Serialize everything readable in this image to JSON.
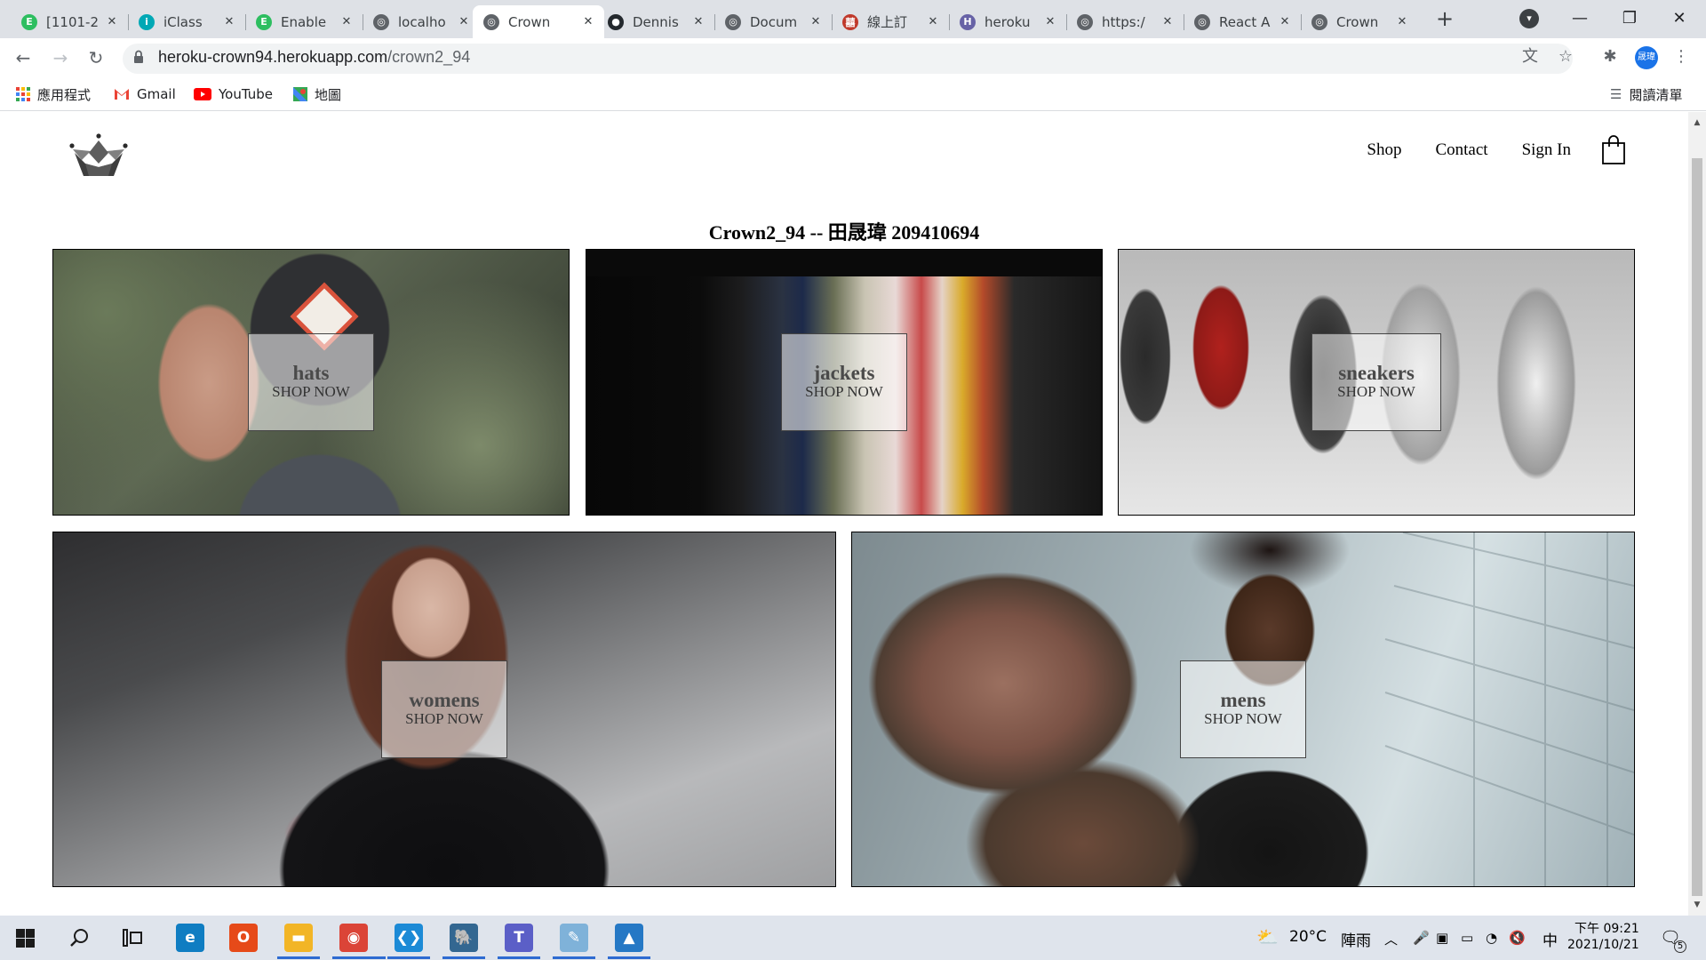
{
  "browser": {
    "tabs": [
      {
        "title": "[1101-2",
        "favicon": "evernote-icon",
        "color": "#2dbe60",
        "glyph": "E"
      },
      {
        "title": "iClass",
        "favicon": "iclass-icon",
        "color": "#00a8b5",
        "glyph": "i"
      },
      {
        "title": "Enable",
        "favicon": "evernote-icon",
        "color": "#2dbe60",
        "glyph": "E"
      },
      {
        "title": "localho",
        "favicon": "globe-icon",
        "color": "#5f6368",
        "glyph": "◎"
      },
      {
        "title": "Crown",
        "favicon": "globe-icon",
        "color": "#5f6368",
        "glyph": "◎"
      },
      {
        "title": "Dennis",
        "favicon": "github-icon",
        "color": "#24292e",
        "glyph": "●"
      },
      {
        "title": "Docum",
        "favicon": "globe-icon",
        "color": "#5f6368",
        "glyph": "◎"
      },
      {
        "title": "線上訂",
        "favicon": "shop-icon",
        "color": "#c0392b",
        "glyph": "囍"
      },
      {
        "title": "heroku",
        "favicon": "heroku-icon",
        "color": "#6762a6",
        "glyph": "H"
      },
      {
        "title": "https:/",
        "favicon": "globe-icon",
        "color": "#5f6368",
        "glyph": "◎"
      },
      {
        "title": "React A",
        "favicon": "globe-icon",
        "color": "#5f6368",
        "glyph": "◎"
      },
      {
        "title": "Crown",
        "favicon": "globe-icon",
        "color": "#5f6368",
        "glyph": "◎"
      }
    ],
    "new_tab": "+",
    "url_host": "heroku-crown94.herokuapp.com",
    "url_path": "/crown2_94",
    "profile_initials": "晟瑋",
    "bookmarks": [
      {
        "label": "應用程式",
        "icon": "apps-grid-icon"
      },
      {
        "label": "Gmail",
        "icon": "gmail-icon"
      },
      {
        "label": "YouTube",
        "icon": "youtube-icon"
      },
      {
        "label": "地圖",
        "icon": "maps-icon"
      }
    ],
    "reading_list": "閱讀清單"
  },
  "site": {
    "nav": {
      "shop": "Shop",
      "contact": "Contact",
      "sign_in": "Sign In"
    },
    "heading": "Crown2_94 -- 田晟瑋 209410694",
    "shop_now": "SHOP NOW",
    "categories": {
      "hats": "hats",
      "jackets": "jackets",
      "sneakers": "sneakers",
      "womens": "womens",
      "mens": "mens"
    }
  },
  "taskbar": {
    "weather_temp": "20°C",
    "weather_desc": "陣雨",
    "ime": "中",
    "time": "下午 09:21",
    "date": "2021/10/21",
    "notification_count": "5",
    "apps": [
      {
        "name": "edge-icon",
        "color": "#0f7dc2",
        "glyph": "e"
      },
      {
        "name": "office-icon",
        "color": "#e64a19",
        "glyph": "O"
      },
      {
        "name": "file-explorer-icon",
        "color": "#f2b526",
        "glyph": "▬"
      },
      {
        "name": "chrome-icon",
        "color": "#db4437",
        "glyph": "◉"
      },
      {
        "name": "vscode-icon",
        "color": "#1c8ad6",
        "glyph": "❮❯"
      },
      {
        "name": "pgadmin-icon",
        "color": "#336791",
        "glyph": "🐘"
      },
      {
        "name": "teams-icon",
        "color": "#5b5fc7",
        "glyph": "T"
      },
      {
        "name": "paint-icon",
        "color": "#7fb2d9",
        "glyph": "✎"
      },
      {
        "name": "photos-icon",
        "color": "#2578c5",
        "glyph": "▲"
      }
    ]
  }
}
